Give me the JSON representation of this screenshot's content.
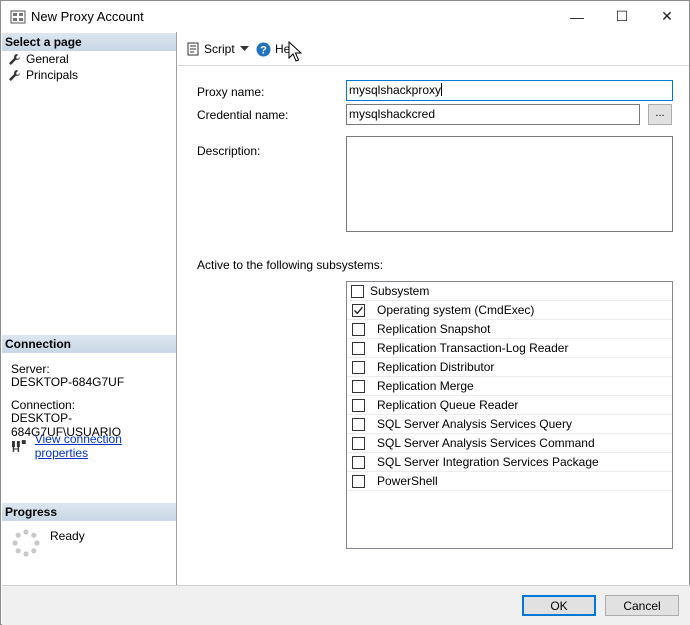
{
  "window": {
    "title": "New Proxy Account",
    "minimize_glyph": "—",
    "maximize_glyph": "☐",
    "close_glyph": "✕"
  },
  "left_pane": {
    "select_page_header": "Select a page",
    "pages": [
      {
        "label": "General",
        "icon": "wrench-icon"
      },
      {
        "label": "Principals",
        "icon": "wrench-icon"
      }
    ],
    "connection_header": "Connection",
    "server_label": "Server:",
    "server_value": "DESKTOP-684G7UF",
    "connection_label": "Connection:",
    "connection_value": "DESKTOP-684G7UF\\USUARIO",
    "view_connection_link": "View connection properties",
    "progress_header": "Progress",
    "progress_status": "Ready"
  },
  "toolbar": {
    "script_label": "Script",
    "help_label": "Hel"
  },
  "form": {
    "proxy_name_label": "Proxy name:",
    "proxy_name_value": "mysqlshackproxy",
    "credential_name_label": "Credential name:",
    "credential_name_value": "mysqlshackcred",
    "browse_label": "...",
    "description_label": "Description:",
    "subsystems_label": "Active to the following subsystems:",
    "subsystem_header": "Subsystem",
    "subsystems": [
      {
        "label": "Operating system (CmdExec)",
        "checked": true
      },
      {
        "label": "Replication Snapshot",
        "checked": false
      },
      {
        "label": "Replication Transaction-Log Reader",
        "checked": false
      },
      {
        "label": "Replication Distributor",
        "checked": false
      },
      {
        "label": "Replication Merge",
        "checked": false
      },
      {
        "label": "Replication Queue Reader",
        "checked": false
      },
      {
        "label": "SQL Server Analysis Services Query",
        "checked": false
      },
      {
        "label": "SQL Server Analysis Services Command",
        "checked": false
      },
      {
        "label": "SQL Server Integration Services Package",
        "checked": false
      },
      {
        "label": "PowerShell",
        "checked": false
      }
    ]
  },
  "buttons": {
    "ok_label": "OK",
    "cancel_label": "Cancel"
  }
}
